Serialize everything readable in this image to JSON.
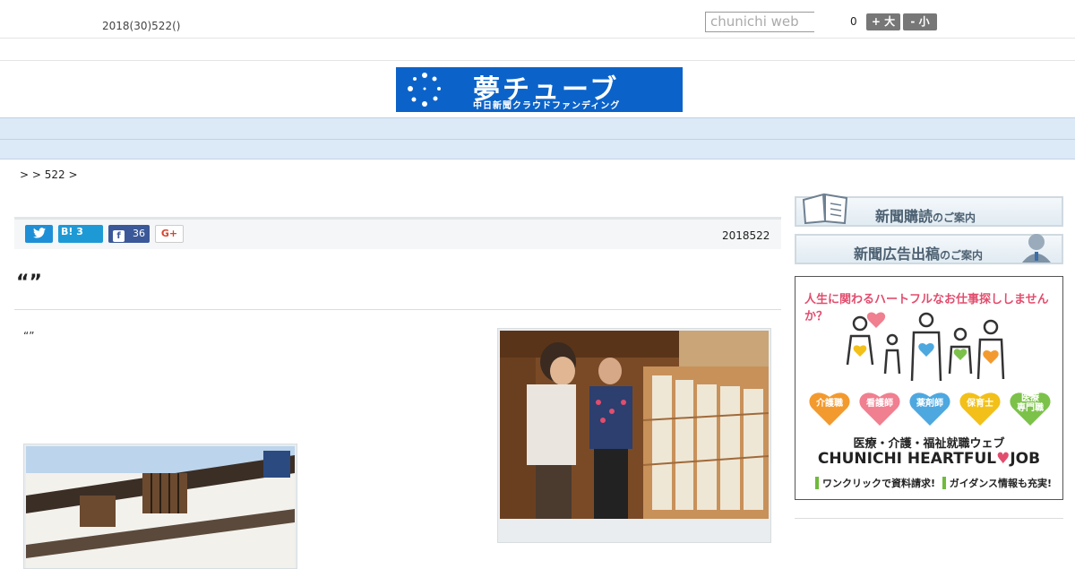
{
  "header": {
    "date": "2018(30)522()",
    "search_placeholder": "chunichi web",
    "font_zoom_value": "0",
    "font_larger_label": "+ 大",
    "font_smaller_label": "- 小"
  },
  "banner": {
    "title": "夢チューブ",
    "subtitle": "中日新聞クラウドファンディング",
    "color": "#0b63c9"
  },
  "nav": {
    "items": [
      "",
      "",
      "",
      "",
      "",
      "",
      "",
      "",
      ""
    ]
  },
  "breadcrumb": ">  > 522 >",
  "share": {
    "twitter_icon": "twitter-bird-icon",
    "hatena_label": "B! 3",
    "facebook_icon_glyph": "f",
    "facebook_count": "36",
    "gplus_label": "G+"
  },
  "article": {
    "date": "2018522",
    "title": "“”",
    "body": "“”"
  },
  "sidebar": {
    "subscribe_main": "新聞購読",
    "subscribe_small": "のご案内",
    "ad_main": "新聞広告出稿",
    "ad_small": "のご案内",
    "promo": {
      "headline": "人生に関わるハートフルなお仕事探ししませんか？",
      "categories": [
        "介護職",
        "看護師",
        "薬剤師",
        "保育士",
        "医療\n専門職"
      ],
      "category_colors": [
        "#f39a2e",
        "#f07f90",
        "#4da8e0",
        "#f2c018",
        "#7cc24a"
      ],
      "subtitle": "医療・介護・福祉就職ウェブ",
      "brand_left": "CHUNICHI HEARTFUL",
      "brand_heart": "♥",
      "brand_right": "JOB",
      "footer_left": "ワンクリックで資料請求!",
      "footer_right": "ガイダンス情報も充実!"
    }
  }
}
